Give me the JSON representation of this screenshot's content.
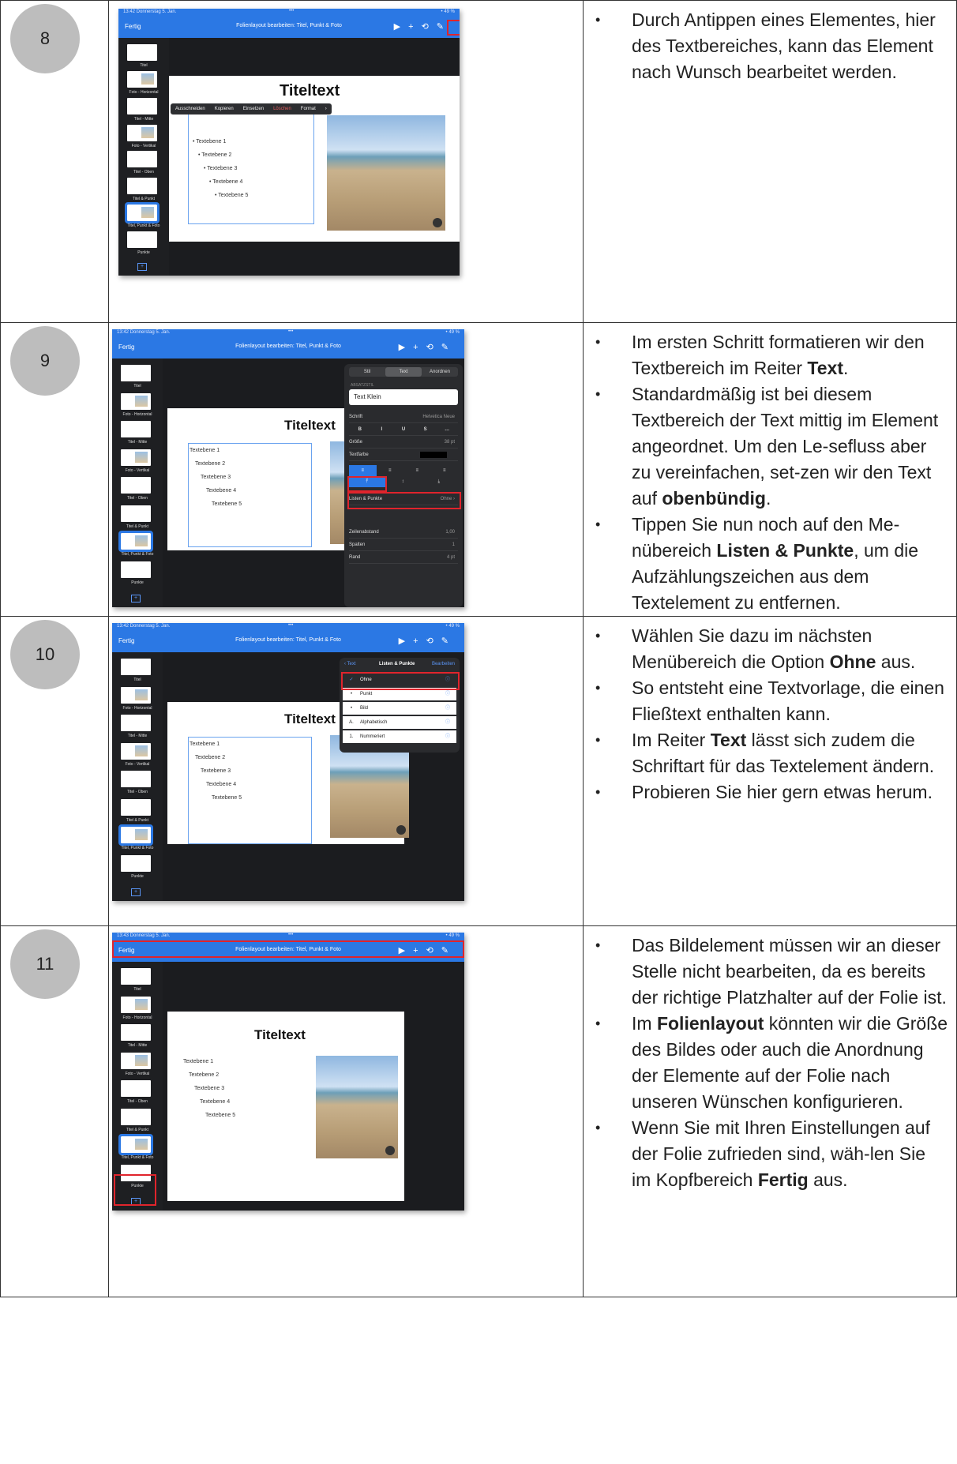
{
  "rows": [
    {
      "number": "8",
      "screenshot": {
        "status_time": "13:42  Donnerstag 5. Jan.",
        "status_right": "• 49 %",
        "done": "Fertig",
        "nav_title": "Folienlayout bearbeiten: Titel, Punkt & Foto",
        "slide_title": "Titeltext",
        "edit_menu": [
          "Ausschneiden",
          "Kopieren",
          "Einsetzen",
          "Löschen",
          "Format",
          "›"
        ],
        "text_levels": [
          "• Textebene 1",
          "• Textebene 2",
          "• Textebene 3",
          "• Textebene 4",
          "• Textebene 5"
        ],
        "thumb_labels": [
          "Titel",
          "Foto - Horizontal",
          "Titel - Mitte",
          "Foto - Vertikal",
          "Titel - Oben",
          "Titel & Punkt",
          "Titel, Punkt & Foto",
          "Punkte"
        ]
      },
      "bullets": [
        [
          {
            "t": "Durch Antippen eines Elementes, hier des Textbereiches, kann das Element nach Wunsch bearbeitet werden."
          }
        ]
      ]
    },
    {
      "number": "9",
      "screenshot": {
        "status_time": "13:42  Donnerstag 5. Jan.",
        "done": "Fertig",
        "nav_title": "Folienlayout bearbeiten: Titel, Punkt & Foto",
        "slide_title": "Titeltext",
        "text_levels": [
          "Textebene 1",
          "Textebene 2",
          "Textebene 3",
          "Textebene 4",
          "Textebene 5"
        ],
        "thumb_labels": [
          "Titel",
          "Foto - Horizontal",
          "Titel - Mitte",
          "Foto - Vertikal",
          "Titel - Oben",
          "Titel & Punkt",
          "Titel, Punkt & Foto",
          "Punkte"
        ],
        "panel_tabs": [
          "Stil",
          "Text",
          "Anordnen"
        ],
        "panel_section": "ABSATZSTIL",
        "paragraph_style": "Text Klein",
        "font_label": "Schrift",
        "font_value": "Helvetica Neue",
        "format_buttons": [
          "B",
          "I",
          "U",
          "S",
          "…"
        ],
        "size_label": "Größe",
        "size_value": "38 pt",
        "color_label": "Textfarbe",
        "lists_label": "Listen & Punkte",
        "lists_value": "Ohne",
        "spacing_label": "Zeilenabstand",
        "spacing_value": "1,00",
        "columns_label": "Spalten",
        "columns_value": "1",
        "margin_label": "Rand",
        "margin_value": "4 pt"
      },
      "bullets": [
        [
          {
            "t": "Im ersten Schritt formatieren wir den Textbereich im Reiter "
          },
          {
            "t": "Text",
            "b": true
          },
          {
            "t": "."
          }
        ],
        [
          {
            "t": "Standardmäßig ist bei diesem Textbereich der Text mittig im Element angeordnet. Um den Le-sefluss aber zu vereinfachen, set-zen wir den Text auf "
          },
          {
            "t": "obenbündig",
            "b": true
          },
          {
            "t": "."
          }
        ],
        [
          {
            "t": "Tippen Sie nun noch auf den Me-nübereich "
          },
          {
            "t": "Listen & Punkte",
            "b": true
          },
          {
            "t": ", um die Aufzählungszeichen aus dem Textelement zu entfernen."
          }
        ]
      ]
    },
    {
      "number": "10",
      "screenshot": {
        "status_time": "13:42  Donnerstag 5. Jan.",
        "done": "Fertig",
        "nav_title": "Folienlayout bearbeiten: Titel, Punkt & Foto",
        "slide_title": "Titeltext",
        "text_levels": [
          "Textebene 1",
          "Textebene 2",
          "Textebene 3",
          "Textebene 4",
          "Textebene 5"
        ],
        "thumb_labels": [
          "Titel",
          "Foto - Horizontal",
          "Titel - Mitte",
          "Foto - Vertikal",
          "Titel - Oben",
          "Titel & Punkt",
          "Titel, Punkt & Foto",
          "Punkte"
        ],
        "popup_back": "‹ Text",
        "popup_title": "Listen & Punkte",
        "popup_edit": "Bearbeiten",
        "options": [
          "Ohne",
          "Punkt",
          "Bild",
          "Alphabetisch",
          "Nummeriert"
        ],
        "option_marks": [
          "✓",
          "•",
          "•",
          "A.",
          "1."
        ]
      },
      "bullets": [
        [
          {
            "t": "Wählen Sie dazu im nächsten Menübereich die Option "
          },
          {
            "t": "Ohne",
            "b": true
          },
          {
            "t": " aus."
          }
        ],
        [
          {
            "t": "So entsteht eine Textvorlage, die einen Fließtext enthalten kann."
          }
        ],
        [
          {
            "t": "Im Reiter "
          },
          {
            "t": "Text",
            "b": true
          },
          {
            "t": " lässt sich zudem die Schriftart für das Textelement ändern."
          }
        ],
        [
          {
            "t": "Probieren Sie hier gern etwas herum."
          }
        ]
      ]
    },
    {
      "number": "11",
      "screenshot": {
        "status_time": "13:43  Donnerstag 5. Jan.",
        "done": "Fertig",
        "nav_title": "Folienlayout bearbeiten: Titel, Punkt & Foto",
        "slide_title": "Titeltext",
        "text_levels": [
          "Textebene 1",
          "Textebene 2",
          "Textebene 3",
          "Textebene 4",
          "Textebene 5"
        ],
        "thumb_labels": [
          "Titel",
          "Foto - Horizontal",
          "Titel - Mitte",
          "Foto - Vertikal",
          "Titel - Oben",
          "Titel & Punkt",
          "Titel, Punkt & Foto",
          "Punkte"
        ]
      },
      "bullets": [
        [
          {
            "t": "Das Bildelement müssen wir an dieser Stelle nicht bearbeiten, da es bereits der richtige Platzhalter auf der Folie ist."
          }
        ],
        [
          {
            "t": "Im "
          },
          {
            "t": "Folienlayout",
            "b": true
          },
          {
            "t": " könnten wir die Größe des Bildes oder auch die Anordnung der Elemente auf der Folie nach unseren Wünschen konfigurieren."
          }
        ],
        [
          {
            "t": "Wenn Sie mit Ihren Einstellungen auf der Folie zufrieden sind, wäh-len Sie im Kopfbereich "
          },
          {
            "t": "Fertig",
            "b": true
          },
          {
            "t": " aus."
          }
        ]
      ]
    }
  ],
  "colors": {
    "accent": "#2b78e4",
    "highlight": "#e0242c",
    "circle": "#bdbdbd"
  }
}
